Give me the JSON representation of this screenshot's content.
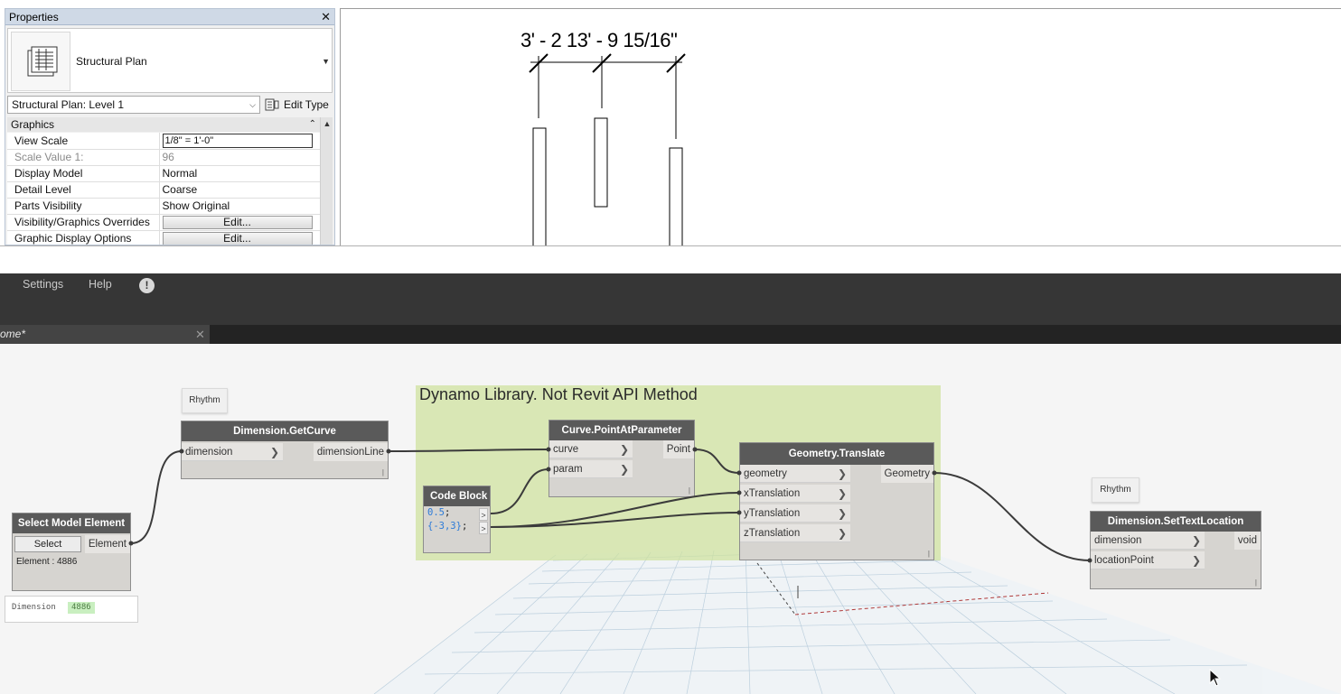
{
  "properties": {
    "title": "Properties",
    "type_name": "Structural Plan",
    "view_selector": "Structural Plan: Level 1",
    "edit_type": "Edit Type",
    "section": "Graphics",
    "rows": [
      {
        "name": "View Scale",
        "value": "1/8\" = 1'-0\""
      },
      {
        "name": "Scale Value    1:",
        "value": "96"
      },
      {
        "name": "Display Model",
        "value": "Normal"
      },
      {
        "name": "Detail Level",
        "value": "Coarse"
      },
      {
        "name": "Parts Visibility",
        "value": "Show Original"
      },
      {
        "name": "Visibility/Graphics Overrides",
        "value": "Edit..."
      },
      {
        "name": "Graphic Display Options",
        "value": "Edit..."
      }
    ]
  },
  "view": {
    "dimension_text": "3' - 2 13' - 9 15/16\""
  },
  "dynamo": {
    "menu": {
      "settings": "Settings",
      "help": "Help",
      "alert": "!"
    },
    "tab": {
      "label": "ome*",
      "close": "✕"
    },
    "group": {
      "title": "Dynamo Library. Not Revit API Method",
      "color": "#cfe29d"
    },
    "notes": [
      "Rhythm",
      "Rhythm"
    ],
    "nodes": {
      "select_model_element": {
        "title": "Select Model Element",
        "button": "Select",
        "output": "Element",
        "info": "Element : 4886"
      },
      "get_curve": {
        "title": "Dimension.GetCurve",
        "input": "dimension",
        "output": "dimensionLine"
      },
      "code_block": {
        "title": "Code Block",
        "line1": "0.5",
        "line2": "{-3,3}",
        "out": ">"
      },
      "point_at_parameter": {
        "title": "Curve.PointAtParameter",
        "inputs": [
          "curve",
          "param"
        ],
        "output": "Point"
      },
      "translate": {
        "title": "Geometry.Translate",
        "inputs": [
          "geometry",
          "xTranslation",
          "yTranslation",
          "zTranslation"
        ],
        "output": "Geometry"
      },
      "set_text_location": {
        "title": "Dimension.SetTextLocation",
        "inputs": [
          "dimension",
          "locationPoint"
        ],
        "output": "void"
      }
    },
    "watch": {
      "label": "Dimension",
      "value": "4886"
    },
    "node_foot": "|"
  }
}
